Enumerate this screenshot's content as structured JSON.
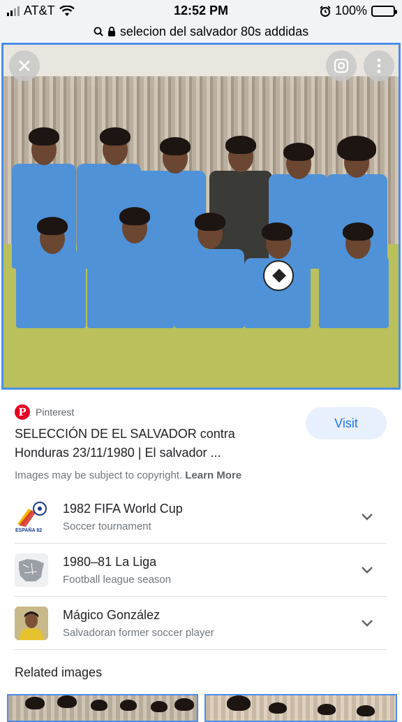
{
  "status_bar": {
    "carrier": "AT&T",
    "time": "12:52 PM",
    "battery": "100%"
  },
  "url_bar": {
    "query": "selecion del salvador 80s addidas"
  },
  "result": {
    "source": "Pinterest",
    "title_line1": "SELECCIÓN DE EL SALVADOR contra",
    "title_line2": "Honduras 23/11/1980 | El salvador ...",
    "visit_label": "Visit",
    "copyright_text": "Images may be subject to copyright.",
    "learn_more": "Learn More"
  },
  "entities": [
    {
      "name": "1982 FIFA World Cup",
      "desc": "Soccer tournament",
      "icon": "world-cup-logo",
      "logo_text": "ESPAÑA 82"
    },
    {
      "name": "1980–81 La Liga",
      "desc": "Football league season",
      "icon": "spain-map"
    },
    {
      "name": "Mágico González",
      "desc": "Salvadoran former soccer player",
      "icon": "player-photo"
    }
  ],
  "related": {
    "title": "Related images"
  },
  "colors": {
    "accent": "#1a73e8",
    "visit_bg": "#e8f0fe",
    "pinterest": "#e60023",
    "image_border": "#4a8ee8"
  }
}
